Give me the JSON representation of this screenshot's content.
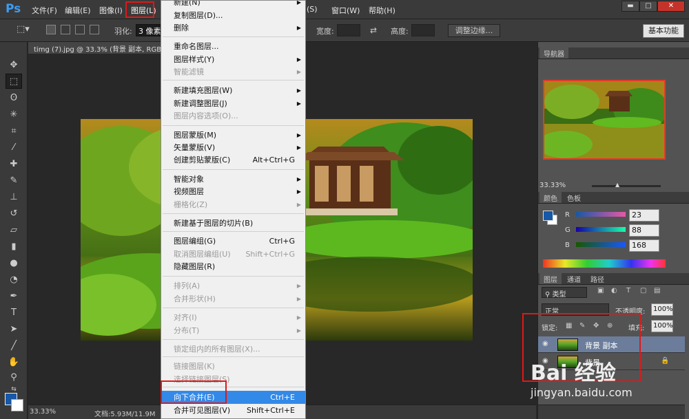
{
  "app": {
    "logo": "Ps"
  },
  "menubar": {
    "file": "文件(F)",
    "edit": "编辑(E)",
    "image": "图像(I)",
    "layer": "图层(L)",
    "select": "(S)",
    "window": "窗口(W)",
    "help": "帮助(H)"
  },
  "options": {
    "feather_label": "羽化:",
    "feather_value": "3 像素",
    "width_label": "宽度:",
    "height_label": "高度:",
    "refine_edge": "调整边缘...",
    "workspace": "基本功能"
  },
  "document": {
    "tab_title": "timg (7).jpg @ 33.3% (背景 副本, RGB/8)",
    "zoom": "33.33%",
    "doc_size": "文档:5.93M/11.9M"
  },
  "layer_menu": {
    "items": [
      {
        "label": "新建(N)",
        "shortcut": "",
        "submenu": true,
        "disabled": false
      },
      {
        "label": "复制图层(D)...",
        "shortcut": "",
        "submenu": false,
        "disabled": false
      },
      {
        "label": "删除",
        "shortcut": "",
        "submenu": true,
        "disabled": false
      },
      {
        "label": "重命名图层...",
        "shortcut": "",
        "submenu": false,
        "disabled": false
      },
      {
        "label": "图层样式(Y)",
        "shortcut": "",
        "submenu": true,
        "disabled": false
      },
      {
        "label": "智能滤镜",
        "shortcut": "",
        "submenu": true,
        "disabled": true
      },
      {
        "label": "新建填充图层(W)",
        "shortcut": "",
        "submenu": true,
        "disabled": false
      },
      {
        "label": "新建调整图层(J)",
        "shortcut": "",
        "submenu": true,
        "disabled": false
      },
      {
        "label": "图层内容选项(O)...",
        "shortcut": "",
        "submenu": false,
        "disabled": true
      },
      {
        "label": "图层蒙版(M)",
        "shortcut": "",
        "submenu": true,
        "disabled": false
      },
      {
        "label": "矢量蒙版(V)",
        "shortcut": "",
        "submenu": true,
        "disabled": false
      },
      {
        "label": "创建剪贴蒙版(C)",
        "shortcut": "Alt+Ctrl+G",
        "submenu": false,
        "disabled": false
      },
      {
        "label": "智能对象",
        "shortcut": "",
        "submenu": true,
        "disabled": false
      },
      {
        "label": "视频图层",
        "shortcut": "",
        "submenu": true,
        "disabled": false
      },
      {
        "label": "栅格化(Z)",
        "shortcut": "",
        "submenu": true,
        "disabled": true
      },
      {
        "label": "新建基于图层的切片(B)",
        "shortcut": "",
        "submenu": false,
        "disabled": false
      },
      {
        "label": "图层编组(G)",
        "shortcut": "Ctrl+G",
        "submenu": false,
        "disabled": false
      },
      {
        "label": "取消图层编组(U)",
        "shortcut": "Shift+Ctrl+G",
        "submenu": false,
        "disabled": true
      },
      {
        "label": "隐藏图层(R)",
        "shortcut": "",
        "submenu": false,
        "disabled": false
      },
      {
        "label": "排列(A)",
        "shortcut": "",
        "submenu": true,
        "disabled": true
      },
      {
        "label": "合并形状(H)",
        "shortcut": "",
        "submenu": true,
        "disabled": true
      },
      {
        "label": "对齐(I)",
        "shortcut": "",
        "submenu": true,
        "disabled": true
      },
      {
        "label": "分布(T)",
        "shortcut": "",
        "submenu": true,
        "disabled": true
      },
      {
        "label": "锁定组内的所有图层(X)...",
        "shortcut": "",
        "submenu": false,
        "disabled": true
      },
      {
        "label": "链接图层(K)",
        "shortcut": "",
        "submenu": false,
        "disabled": true
      },
      {
        "label": "选择链接图层(S)",
        "shortcut": "",
        "submenu": false,
        "disabled": true
      },
      {
        "label": "向下合并(E)",
        "shortcut": "Ctrl+E",
        "submenu": false,
        "disabled": false
      },
      {
        "label": "合并可见图层(V)",
        "shortcut": "Shift+Ctrl+E",
        "submenu": false,
        "disabled": false
      }
    ]
  },
  "panels": {
    "navigator_tab": "导航器",
    "navigator_zoom": "33.33%",
    "color_tab": "颜色",
    "swatches_tab": "色板",
    "color": {
      "r_label": "R",
      "g_label": "G",
      "b_label": "B",
      "r": "23",
      "g": "88",
      "b": "168"
    },
    "layers_tab": "图层",
    "channels_tab": "通道",
    "paths_tab": "路径",
    "kind_filter": "类型",
    "blend_mode": "正常",
    "opacity_label": "不透明度:",
    "opacity": "100%",
    "lock_label": "锁定:",
    "fill_label": "填充:",
    "fill": "100%",
    "layers": [
      {
        "name": "背景 副本"
      },
      {
        "name": "背景"
      }
    ]
  },
  "watermark": {
    "logo": "Bai 经验",
    "url": "jingyan.baidu.com"
  },
  "colors": {
    "foreground": "#1758a8",
    "menu_highlight": "#3389e8",
    "annotation_red": "#e01818",
    "ps_blue": "#3d9df2"
  }
}
